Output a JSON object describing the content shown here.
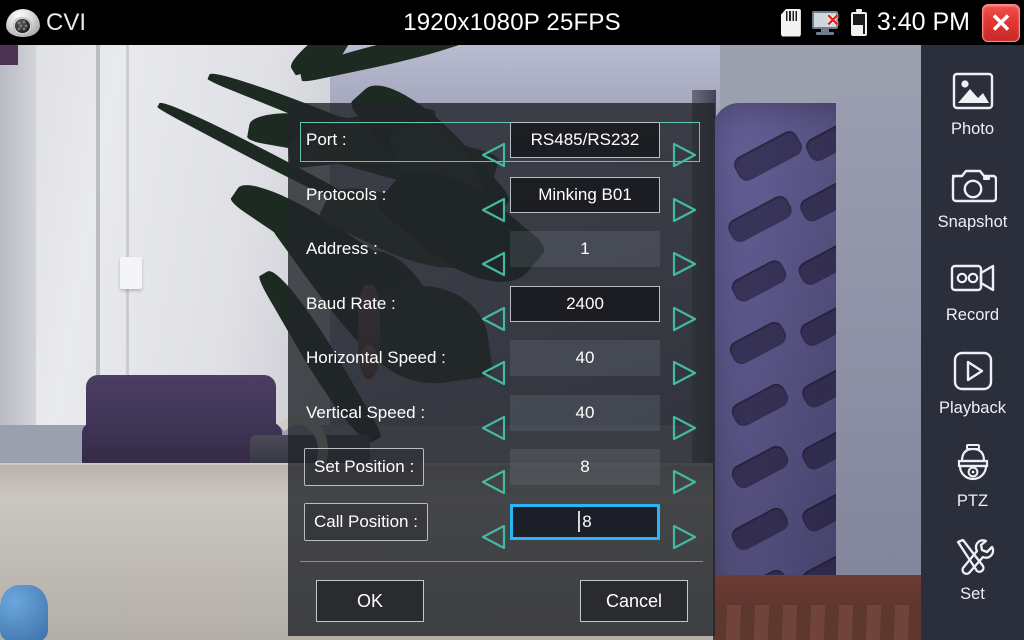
{
  "statusbar": {
    "brand": "CVI",
    "brand_icon": "dome-camera-icon",
    "resolution": "1920x1080P 25FPS",
    "sd_icon": "sd-card-icon",
    "network_icon": "monitor-disconnected-icon",
    "battery_icon": "battery-icon",
    "time": "3:40 PM",
    "close_glyph": "✕"
  },
  "dialog": {
    "rows": [
      {
        "label": "Port :",
        "value": "RS485/RS232",
        "box": "framed",
        "label_boxed": false,
        "selected": true,
        "focused": false
      },
      {
        "label": "Protocols :",
        "value": "Minking B01",
        "box": "framed",
        "label_boxed": false,
        "selected": false,
        "focused": false
      },
      {
        "label": "Address :",
        "value": "1",
        "box": "plain",
        "label_boxed": false,
        "selected": false,
        "focused": false
      },
      {
        "label": "Baud Rate :",
        "value": "2400",
        "box": "framed",
        "label_boxed": false,
        "selected": false,
        "focused": false
      },
      {
        "label": "Horizontal Speed :",
        "value": "40",
        "box": "plain",
        "label_boxed": false,
        "selected": false,
        "focused": false
      },
      {
        "label": "Vertical Speed :",
        "value": "40",
        "box": "plain",
        "label_boxed": false,
        "selected": false,
        "focused": false
      },
      {
        "label": "Set Position :",
        "value": "8",
        "box": "plain",
        "label_boxed": true,
        "selected": false,
        "focused": false
      },
      {
        "label": "Call Position :",
        "value": "8",
        "box": "focused",
        "label_boxed": true,
        "selected": false,
        "focused": true
      }
    ],
    "left_arrow_icon": "triangle-left-icon",
    "right_arrow_icon": "triangle-right-icon",
    "ok_label": "OK",
    "cancel_label": "Cancel"
  },
  "sidebar": {
    "items": [
      {
        "label": "Photo",
        "icon": "photo-icon"
      },
      {
        "label": "Snapshot",
        "icon": "camera-icon"
      },
      {
        "label": "Record",
        "icon": "video-camera-icon"
      },
      {
        "label": "Playback",
        "icon": "play-icon"
      },
      {
        "label": "PTZ",
        "icon": "dome-camera-icon"
      },
      {
        "label": "Set",
        "icon": "tools-icon"
      }
    ]
  },
  "colors": {
    "accent_teal": "#5fc6b4",
    "focus_blue": "#29b6f6",
    "sidebar_bg": "#2b2f3b",
    "dialog_bg": "rgba(34,36,41,0.80)",
    "close_red": "#e53935"
  }
}
